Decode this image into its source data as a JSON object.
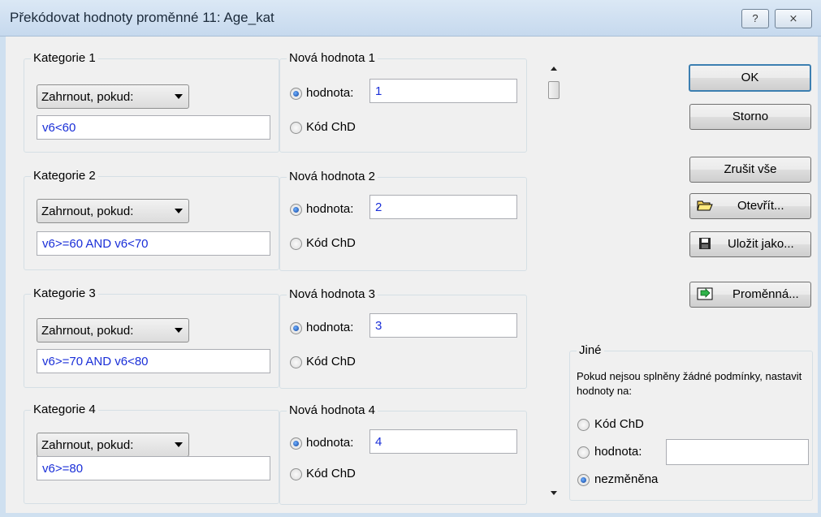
{
  "window": {
    "title": "Překódovat hodnoty proměnné 11: Age_kat",
    "help_glyph": "?",
    "close_glyph": "⨯"
  },
  "categories": [
    {
      "title": "Kategorie 1",
      "combo": "Zahrnout, pokud:",
      "condition": "v6<60",
      "new_title": "Nová hodnota 1",
      "radio_value_label": "hodnota:",
      "value": "1",
      "radio_md_label": "Kód ChD"
    },
    {
      "title": "Kategorie 2",
      "combo": "Zahrnout, pokud:",
      "condition": "v6>=60 AND v6<70",
      "new_title": "Nová hodnota 2",
      "radio_value_label": "hodnota:",
      "value": "2",
      "radio_md_label": "Kód ChD"
    },
    {
      "title": "Kategorie 3",
      "combo": "Zahrnout, pokud:",
      "condition": "v6>=70 AND v6<80",
      "new_title": "Nová hodnota 3",
      "radio_value_label": "hodnota:",
      "value": "3",
      "radio_md_label": "Kód ChD"
    },
    {
      "title": "Kategorie 4",
      "combo": "Zahrnout, pokud:",
      "condition": "v6>=80",
      "new_title": "Nová hodnota 4",
      "radio_value_label": "hodnota:",
      "value": "4",
      "radio_md_label": "Kód ChD"
    }
  ],
  "buttons": {
    "ok": "OK",
    "cancel": "Storno",
    "clear_all": "Zrušit vše",
    "open": "Otevřít...",
    "save_as": "Uložit jako...",
    "variable": "Proměnná..."
  },
  "other": {
    "title": "Jiné",
    "note": "Pokud nejsou splněny žádné podmínky, nastavit hodnoty na:",
    "md_label": "Kód ChD",
    "value_label": "hodnota:",
    "value": "",
    "unchanged_label": "nezměněna",
    "selected": "unchanged"
  },
  "colors": {
    "value_text": "#1a2fd8",
    "titlebar": "#c6d9ee"
  }
}
